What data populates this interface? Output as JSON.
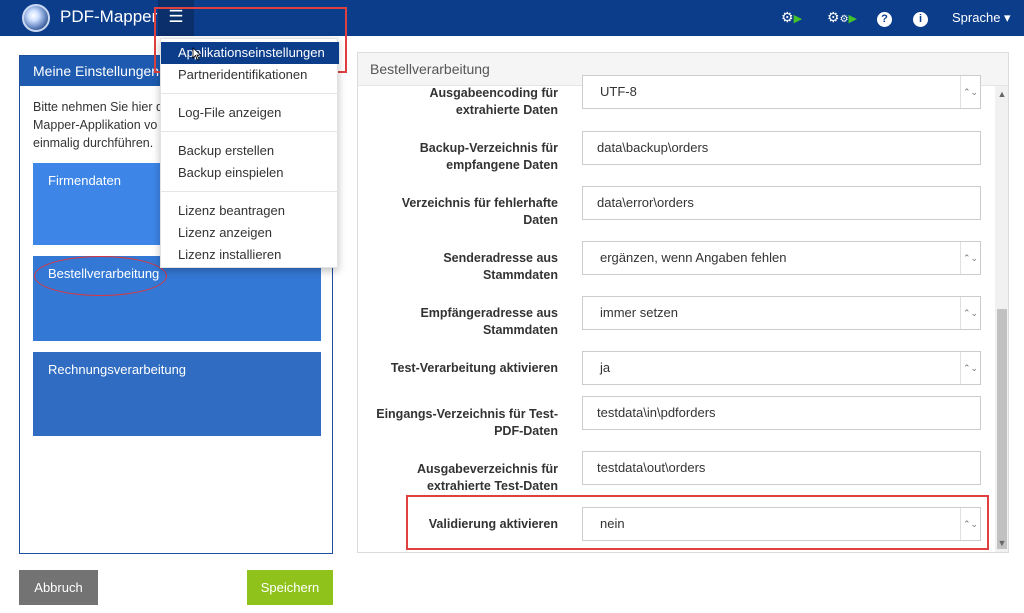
{
  "navbar": {
    "brand": "PDF-Mapper",
    "menu_icon": "hamburger-icon",
    "icons": [
      "gear-play-icon",
      "gears-play-icon",
      "help-icon",
      "info-icon"
    ],
    "help_glyph": "?",
    "info_glyph": "i",
    "language_label": "Sprache ▾"
  },
  "dropdown": {
    "items": [
      "Applikationseinstellungen",
      "Partneridentifikationen",
      "Log-File anzeigen",
      "Backup erstellen",
      "Backup einspielen",
      "Lizenz beantragen",
      "Lizenz anzeigen",
      "Lizenz installieren"
    ]
  },
  "left_panel": {
    "title": "Meine Einstellungen",
    "intro_lines": [
      "Bitte nehmen Sie hier d",
      "Mapper-Applikation vo",
      "einmalig durchführen."
    ],
    "tiles": [
      "Firmendaten",
      "Bestellverarbeitung",
      "Rechnungsverarbeitung"
    ]
  },
  "buttons": {
    "cancel": "Abbruch",
    "save": "Speichern"
  },
  "right_panel": {
    "title": "Bestellverarbeitung",
    "rows": [
      {
        "label_lines": [
          "Ausgabeencoding für",
          "extrahierte Daten"
        ],
        "value": "UTF-8",
        "type": "select"
      },
      {
        "label_lines": [
          "Backup-Verzeichnis für",
          "empfangene Daten"
        ],
        "value": "data\\backup\\orders",
        "type": "text"
      },
      {
        "label_lines": [
          "Verzeichnis für fehlerhafte",
          "Daten"
        ],
        "value": "data\\error\\orders",
        "type": "text"
      },
      {
        "label_lines": [
          "Senderadresse aus",
          "Stammdaten"
        ],
        "value": "ergänzen, wenn Angaben fehlen",
        "type": "select"
      },
      {
        "label_lines": [
          "Empfängeradresse aus",
          "Stammdaten"
        ],
        "value": "immer setzen",
        "type": "select"
      },
      {
        "label_lines": [
          "Test-Verarbeitung aktivieren",
          ""
        ],
        "value": "ja",
        "type": "select"
      },
      {
        "label_lines": [
          "Eingangs-Verzeichnis für Test-",
          "PDF-Daten"
        ],
        "value": "testdata\\in\\pdforders",
        "type": "text"
      },
      {
        "label_lines": [
          "Ausgabeverzeichnis für",
          "extrahierte Test-Daten"
        ],
        "value": "testdata\\out\\orders",
        "type": "text"
      },
      {
        "label_lines": [
          "Validierung aktivieren",
          ""
        ],
        "value": "nein",
        "type": "select"
      }
    ]
  },
  "colors": {
    "navbar": "#0b3d8b",
    "panel_header": "#1d5ab0",
    "save_button": "#8fc21b",
    "cancel_button": "#737373",
    "highlight": "#e0403f"
  }
}
